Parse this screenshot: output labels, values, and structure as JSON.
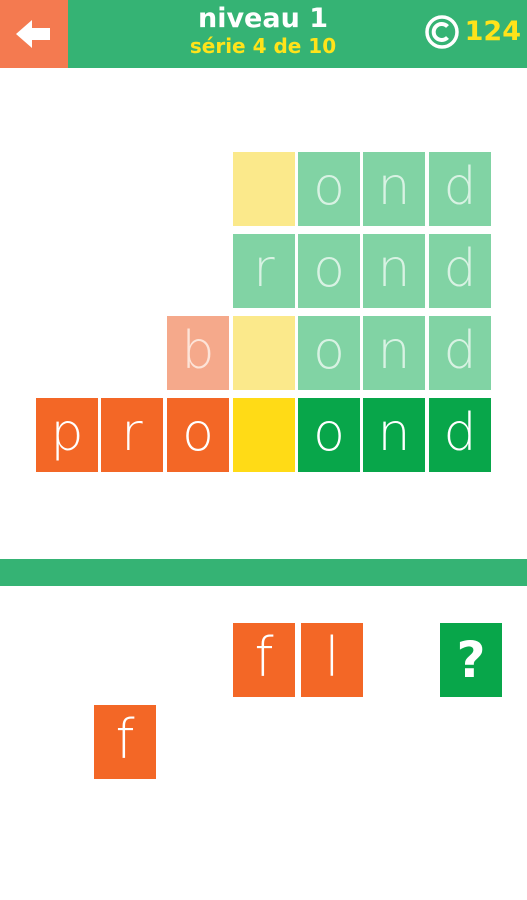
{
  "header": {
    "title": "niveau 1",
    "subtitle": "série 4 de 10",
    "coins": "124",
    "back_icon": "arrow-left-icon",
    "coin_icon": "copyright-coin-icon"
  },
  "colors": {
    "header_bg": "#35b374",
    "back_button_bg": "#f47a50",
    "subtitle_text": "#ffe31a",
    "orange": "#f36726",
    "yellow": "#ffdb16",
    "green": "#08a64a",
    "green_faded": "#81d3a4",
    "yellow_faded": "#fbe98b",
    "salmon_faded": "#f5a98b"
  },
  "board": {
    "rows": [
      [
        "",
        "",
        "",
        "",
        "o",
        "n",
        "d"
      ],
      [
        "",
        "",
        "",
        "r",
        "o",
        "n",
        "d"
      ],
      [
        "",
        "",
        "b",
        "",
        "o",
        "n",
        "d"
      ],
      [
        "p",
        "r",
        "o",
        "",
        "o",
        "n",
        "d"
      ]
    ]
  },
  "choices": {
    "letters": [
      "f",
      "l",
      "f"
    ],
    "hint_label": "?"
  }
}
